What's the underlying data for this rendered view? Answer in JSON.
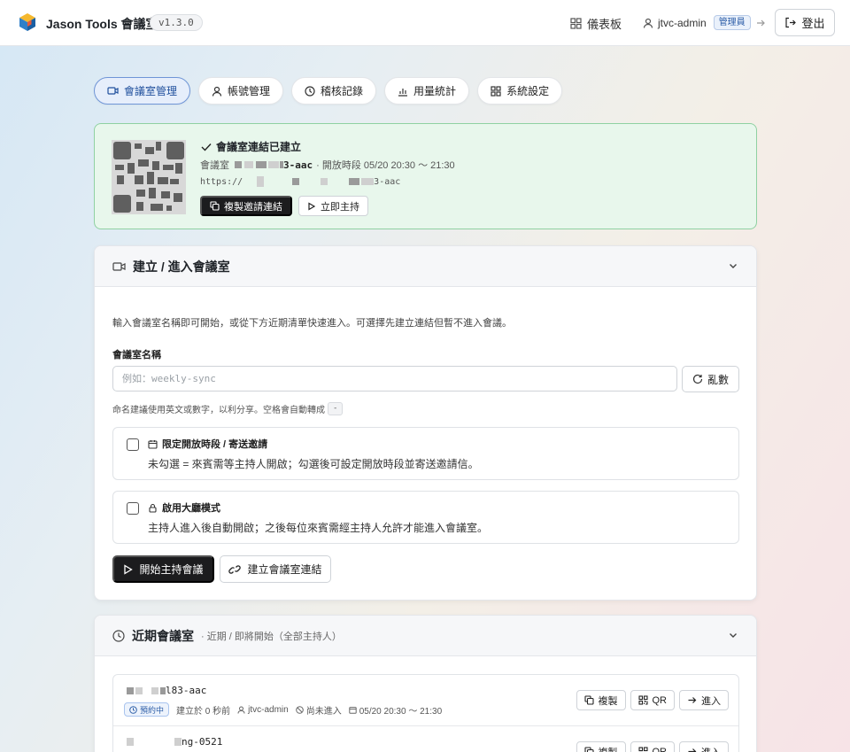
{
  "topbar": {
    "app_title": "Jason Tools 會議室",
    "version": "v1.3.0",
    "dashboard_label": "儀表板",
    "username": "jtvc-admin",
    "role": "管理員",
    "logout_label": "登出"
  },
  "tabs": [
    {
      "label": "會議室管理",
      "icon": "video-icon",
      "active": true
    },
    {
      "label": "帳號管理",
      "icon": "user-icon",
      "active": false
    },
    {
      "label": "稽核記錄",
      "icon": "clock-icon",
      "active": false
    },
    {
      "label": "用量統計",
      "icon": "bar-chart-icon",
      "active": false
    },
    {
      "label": "系統設定",
      "icon": "grid-icon",
      "active": false
    }
  ],
  "banner": {
    "title": "會議室連結已建立",
    "room_prefix": "會議室",
    "room_suffix": "3-aac",
    "schedule": "· 開放時段 05/20 20:30 〜 21:30",
    "url_prefix": "https://",
    "url_suffix": "3-aac",
    "copy_label": "複製邀請連結",
    "host_label": "立即主持"
  },
  "create": {
    "title": "建立 / 進入會議室",
    "intro": "輸入會議室名稱即可開始，或從下方近期清單快速進入。可選擇先建立連結但暫不進入會議。",
    "field_label": "會議室名稱",
    "placeholder": "例如：weekly-sync",
    "value": "",
    "random_label": "亂數",
    "hint": "命名建議使用英文或數字，以利分享。空格會自動轉成",
    "hint_kbd": "-",
    "option_schedule": {
      "title": "限定開放時段 / 寄送邀請",
      "desc": "未勾選 = 來賓需等主持人開啟；勾選後可設定開放時段並寄送邀請信。",
      "checked": false
    },
    "option_lobby": {
      "title": "啟用大廳模式",
      "desc": "主持人進入後自動開啟；之後每位來賓需經主持人允許才能進入會議室。",
      "checked": false
    },
    "start_label": "開始主持會議",
    "link_label": "建立會議室連結"
  },
  "recent": {
    "title": "近期會議室",
    "subtitle": "· 近期 / 即將開始（全部主持人）",
    "rooms": [
      {
        "name_suffix": "l83-aac",
        "status": "預約中",
        "created": "建立於 0 秒前",
        "host": "jtvc-admin",
        "entered": "尚未進入",
        "schedule": "05/20 20:30 〜 21:30"
      },
      {
        "name_suffix": "ng-0521"
      }
    ],
    "copy_label": "複製",
    "qr_label": "QR",
    "enter_label": "進入"
  },
  "colors": {
    "accent": "#2d5ea8",
    "success_bg": "#e8f7ec",
    "success_border": "#8fd1a2",
    "dark_button": "#1c1c1e"
  }
}
